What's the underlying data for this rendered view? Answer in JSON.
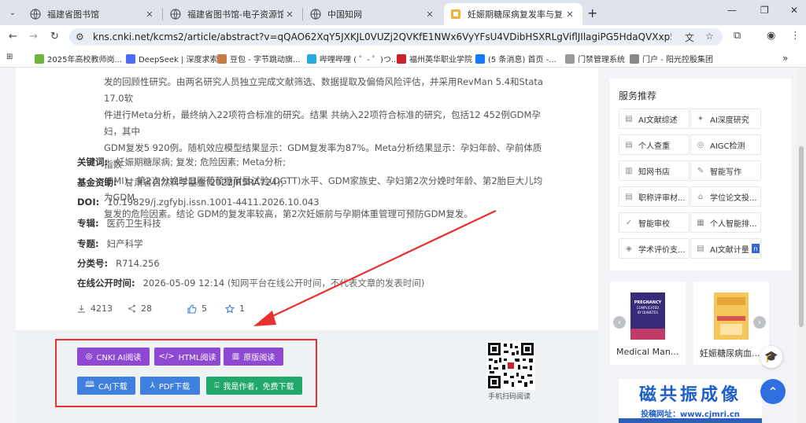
{
  "browser": {
    "tabs": [
      {
        "title": "福建省图书馆",
        "active": false
      },
      {
        "title": "福建省图书馆-电子资源馆外访问",
        "active": false
      },
      {
        "title": "中国知网",
        "active": false
      },
      {
        "title": "妊娠期糖尿病复发率与复发危",
        "active": true
      }
    ],
    "url": "kns.cnki.net/kcms2/article/abstract?v=qQAO62XqY5JXKJL0VUZj2QVKfE1NWx6VyYFsU4VDibHSXRLgViflJIlagiPG5HdaQVXxp5u4TZzpq3t49jlFZlNJr...",
    "bookmarks": [
      "2025年高校教师岗...",
      "DeepSeek | 深度求索",
      "豆包 - 字节跳动旗...",
      "哔哩哔哩 ( ゜- ゜)つ...",
      "福州英华职业学院",
      "(5 条消息) 首页 -...",
      "门禁管理系统",
      "门户 - 阳光控股集团"
    ]
  },
  "article": {
    "abstract_lines": [
      "发的回顾性研究。由两名研究人员独立完成文献筛选、数据提取及偏倚风险评估，并采用RevMan 5.4和Stata 17.0软",
      "件进行Meta分析，最终纳入22项符合标准的研究。结果 共纳入22项符合标准的研究，包括12 452例GDM孕妇，其中",
      "GDM复发5 920例。随机效应模型结果显示：GDM复发率为87%。Meta分析结果显示：孕妇年龄、孕前体质指数",
      "(BMI)、第2次分娩时口服葡萄糖耐量试验(OGTT)水平、GDM家族史、孕妇第2次分娩时年龄、第2胎巨大儿均为GDM",
      "复发的危险因素。结论 GDM的复发率较高，第2次妊娠前与孕期体重管理可预防GDM复发。"
    ],
    "keywords_label": "关键词:",
    "keywords": "妊娠期糖尿病;  复发;  危险因素;  Meta分析;",
    "fund_label": "基金资助:",
    "fund": "甘肃省自然科学基金(2022JR5RA724);",
    "doi_label": "DOI:",
    "doi": "10.19829/j.zgfybj.issn.1001-4411.2026.10.043",
    "series_label": "专辑:",
    "series": "医药卫生科技",
    "topic_label": "专题:",
    "topic": "妇产科学",
    "class_label": "分类号:",
    "class": "R714.256",
    "online_label": "在线公开时间:",
    "online": "2026-05-09 12:14",
    "online_note": "(知网平台在线公开时间，不代表文章的发表时间)",
    "stats": {
      "downloads": "4213",
      "shares": "28",
      "likes": "5",
      "favorites": "1"
    }
  },
  "actions": {
    "ai_read": "CNKI AI阅读",
    "html_read": "HTML阅读",
    "original_read": "原版阅读",
    "caj_download": "CAJ下载",
    "pdf_download": "PDF下载",
    "author_download": "我是作者，免费下载",
    "qr_caption": "手机扫码阅读"
  },
  "sidebar": {
    "title": "服务推荐",
    "services": [
      "AI文献综述",
      "AI深度研究",
      "个人查重",
      "AIGC检测",
      "知网书店",
      "智能写作",
      "职称评审材...",
      "学位论文投...",
      "智能审校",
      "个人智能排...",
      "学术评价支...",
      "AI文献计量"
    ],
    "books": [
      {
        "caption": "Medical Man...",
        "cover_title": "PREGNANCY COMPLICATED BY DIABETES"
      },
      {
        "caption": "妊娠糖尿病血..."
      }
    ],
    "ad_main": "磁共振成像",
    "ad_sub": "投稿网址：www.cjmri.cn"
  },
  "colors": {
    "purple": "#8f48d2",
    "blue": "#3f7fdd",
    "green": "#21a86b",
    "annotation": "#e8312f"
  }
}
